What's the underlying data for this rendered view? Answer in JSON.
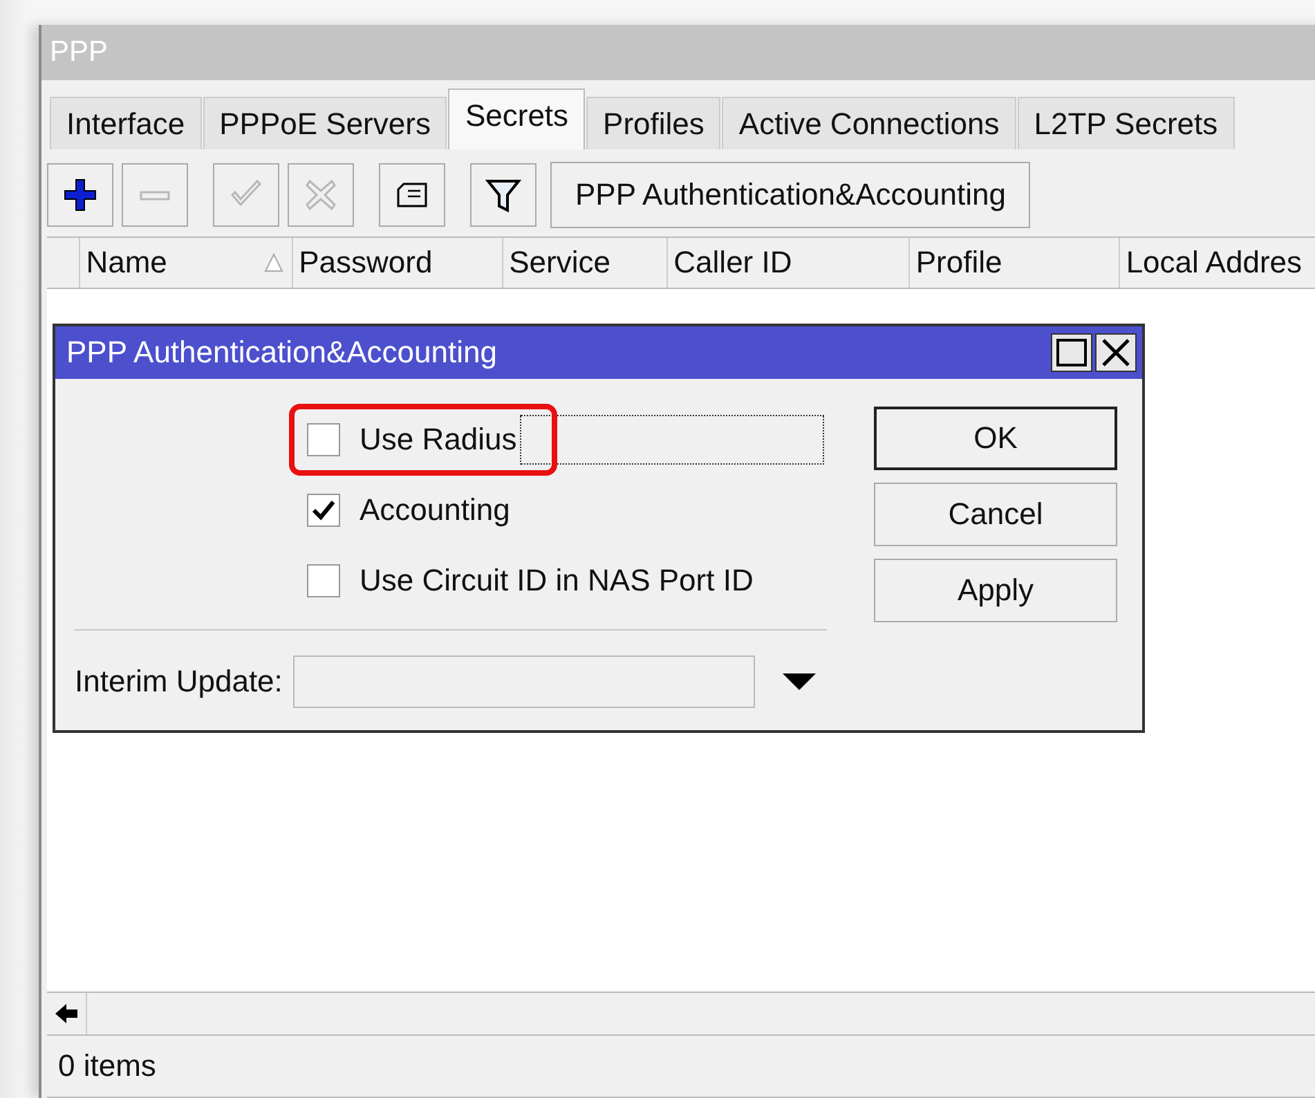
{
  "window": {
    "title": "PPP"
  },
  "tabs": [
    {
      "label": "Interface",
      "selected": false
    },
    {
      "label": "PPPoE Servers",
      "selected": false
    },
    {
      "label": "Secrets",
      "selected": true
    },
    {
      "label": "Profiles",
      "selected": false
    },
    {
      "label": "Active Connections",
      "selected": false
    },
    {
      "label": "L2TP Secrets",
      "selected": false
    }
  ],
  "toolbar": {
    "tools": [
      {
        "kind": "add",
        "disabled": false
      },
      {
        "kind": "remove",
        "disabled": true
      },
      {
        "kind": "enable",
        "disabled": true
      },
      {
        "kind": "disable",
        "disabled": true
      },
      {
        "kind": "comment",
        "disabled": false
      },
      {
        "kind": "filter",
        "disabled": false
      }
    ],
    "button": "PPP Authentication&Accounting"
  },
  "table": {
    "columns": [
      {
        "label": "Name",
        "sorted": true
      },
      {
        "label": "Password",
        "sorted": false
      },
      {
        "label": "Service",
        "sorted": false
      },
      {
        "label": "Caller ID",
        "sorted": false
      },
      {
        "label": "Profile",
        "sorted": false
      },
      {
        "label": "Local Addres",
        "sorted": false
      }
    ]
  },
  "status_bar": "0 items",
  "dialog": {
    "title": "PPP Authentication&Accounting",
    "checkboxes": [
      {
        "label": "Use Radius",
        "checked": false,
        "focused": true,
        "highlighted": true
      },
      {
        "label": "Accounting",
        "checked": true,
        "focused": false,
        "highlighted": false
      },
      {
        "label": "Use Circuit ID in NAS Port ID",
        "checked": false,
        "focused": false,
        "highlighted": false
      }
    ],
    "interim_update": {
      "label": "Interim Update:"
    },
    "buttons": [
      {
        "label": "OK",
        "default": true
      },
      {
        "label": "Cancel",
        "default": false
      },
      {
        "label": "Apply",
        "default": false
      }
    ]
  }
}
